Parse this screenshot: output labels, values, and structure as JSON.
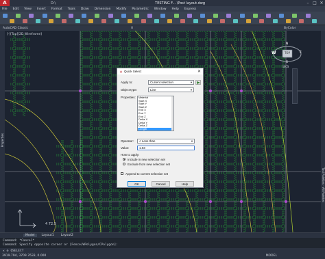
{
  "window": {
    "title": "TESTING F... \\Post layout.dwg",
    "quick_access": "D:\\"
  },
  "menu": [
    "File",
    "Edit",
    "View",
    "Insert",
    "Format",
    "Tools",
    "Draw",
    "Dimension",
    "Modify",
    "Parametric",
    "Window",
    "Help",
    "Express"
  ],
  "ribbon": {
    "workspace": "AutoCAD Classic",
    "layer_value": "0",
    "linetype_value": "ByColor"
  },
  "viewport": {
    "label": "[-][Top][2D Wireframe]",
    "viewcube_face": "TOP",
    "compass": {
      "n": "N",
      "s": "S",
      "w": "W",
      "e": "E"
    },
    "wcs": "WCS",
    "contour_label": "4 72.5"
  },
  "dialog": {
    "title": "Quick Select",
    "apply_to_label": "Apply to:",
    "apply_to_value": "Current selection",
    "object_type_label": "Object type:",
    "object_type_value": "Line",
    "properties_label": "Properties:",
    "properties": [
      "Material",
      "Start X",
      "Start Y",
      "Start Z",
      "End X",
      "End Y",
      "End Z",
      "Delta X",
      "Delta Y",
      "Delta Z",
      "Length",
      "Angle"
    ],
    "selected_property": "Length",
    "operator_label": "Operator:",
    "operator_value": "< Less than",
    "value_label": "Value:",
    "value_value": "1.03",
    "how_to_apply_label": "How to apply:",
    "include_label": "Include in new selection set",
    "exclude_label": "Exclude from new selection set",
    "append_label": "Append to current selection set",
    "ok_label": "OK",
    "cancel_label": "Cancel",
    "help_label": "Help"
  },
  "command": {
    "tabs": [
      "Model",
      "Layout1",
      "Layout2"
    ],
    "history": [
      "Command: *Cancel*",
      "Command: Specify opposite corner or [Fence/WPolygon/CPolygon]:"
    ],
    "input_value": "QSELECT"
  },
  "status": {
    "coords": "3919.794, 3709.7633, 0.000",
    "model_label": "MODEL"
  },
  "palettes": {
    "properties": "Properties",
    "tool_palettes": "Tool Palettes - All Palettes"
  },
  "colors": {
    "accent": "#c0272d",
    "grid_green": "#27c43a",
    "contour_yellow": "#c8c23a",
    "selection_blue": "#3399ff"
  }
}
